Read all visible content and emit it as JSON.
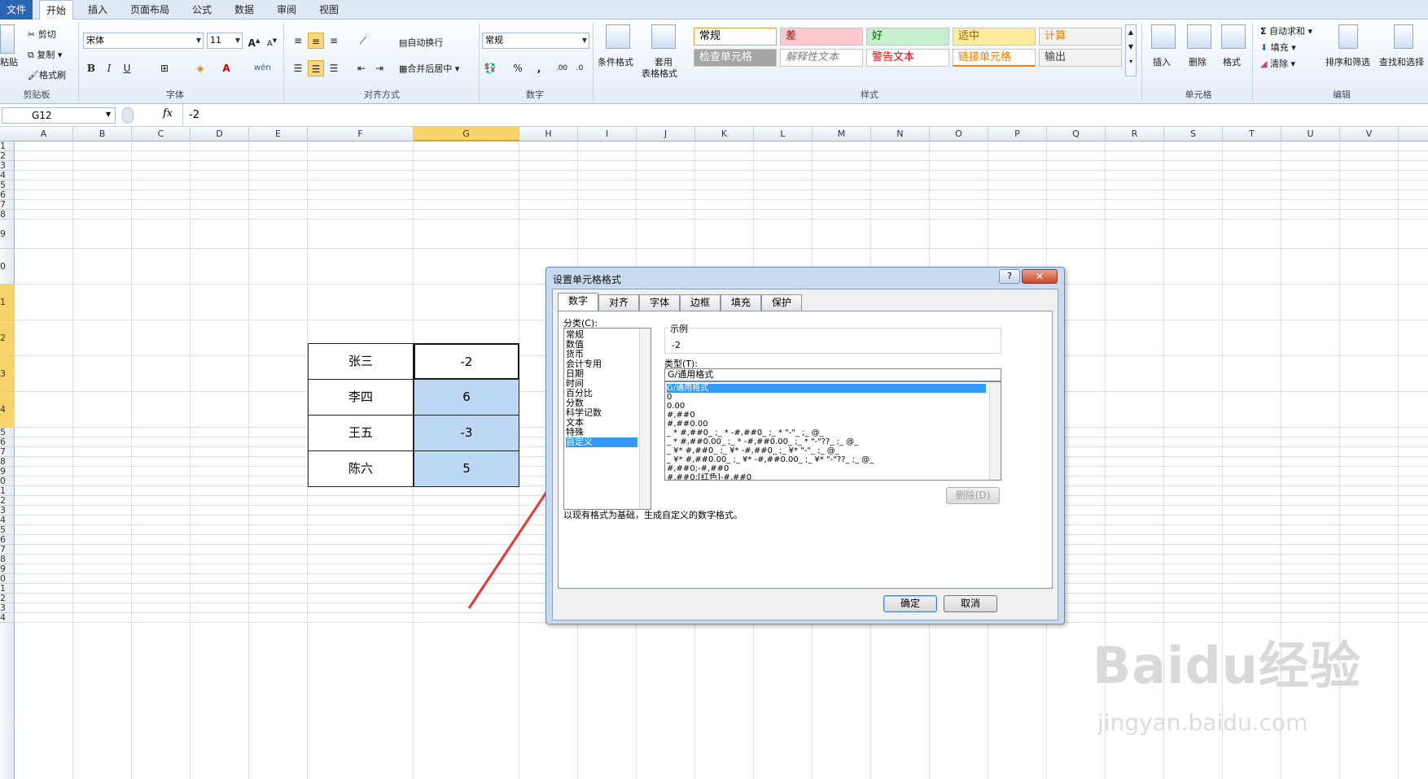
{
  "tabs": [
    "文件",
    "开始",
    "插入",
    "页面布局",
    "公式",
    "数据",
    "审阅",
    "视图"
  ],
  "clipboard": {
    "paste": "粘贴",
    "cut": "剪切",
    "copy": "复制",
    "painter": "格式刷",
    "label": "剪贴板"
  },
  "font": {
    "name": "宋体",
    "size": "11",
    "label": "字体",
    "bold": "B",
    "italic": "I",
    "underline": "U"
  },
  "align": {
    "wrap": "自动换行",
    "merge": "合并后居中",
    "label": "对齐方式"
  },
  "number": {
    "format": "常规",
    "percent": "%",
    "comma": ",",
    "label": "数字"
  },
  "styles": {
    "cond": "条件格式",
    "table": "套用",
    "table2": "表格格式",
    "label": "样式",
    "boxes": [
      {
        "text": "常规",
        "bg": "#ffffff",
        "color": "#000000"
      },
      {
        "text": "差",
        "bg": "#ffc7ce",
        "color": "#9c0006"
      },
      {
        "text": "好",
        "bg": "#c6efce",
        "color": "#006100"
      },
      {
        "text": "适中",
        "bg": "#ffeb9c",
        "color": "#9c6500"
      },
      {
        "text": "计算",
        "bg": "#f2f2f2",
        "color": "#fa7d00"
      },
      {
        "text": "检查单元格",
        "bg": "#a5a5a5",
        "color": "#ffffff"
      },
      {
        "text": "解释性文本",
        "bg": "#ffffff",
        "color": "#7f7f7f"
      },
      {
        "text": "警告文本",
        "bg": "#ffffff",
        "color": "#ff0000"
      },
      {
        "text": "链接单元格",
        "bg": "#ffffff",
        "color": "#fa7d00"
      },
      {
        "text": "输出",
        "bg": "#f2f2f2",
        "color": "#3f3f3f"
      }
    ]
  },
  "cellsgrp": {
    "insert": "插入",
    "delete": "删除",
    "format": "格式",
    "label": "单元格"
  },
  "editing": {
    "autosum": "自动求和",
    "fill": "填充",
    "clear": "清除",
    "sort": "排序和筛选",
    "find": "查找和选择",
    "label": "编辑"
  },
  "formula": {
    "namebox": "G12",
    "fx": "fx",
    "value": "-2"
  },
  "columns": [
    "A",
    "B",
    "C",
    "D",
    "E",
    "F",
    "G",
    "H",
    "I",
    "J",
    "K",
    "L",
    "M",
    "N",
    "O",
    "P",
    "Q",
    "R",
    "S",
    "T",
    "U",
    "V"
  ],
  "rows": [
    "1",
    "2",
    "3",
    "4",
    "5",
    "6",
    "7",
    "8",
    "9",
    "0",
    "1",
    "2",
    "3",
    "4",
    "5",
    "6",
    "7",
    "8",
    "9",
    "0",
    "1",
    "2",
    "3",
    "4",
    "5",
    "6",
    "7",
    "8",
    "9",
    "0",
    "1",
    "2",
    "3",
    "4"
  ],
  "table": [
    {
      "name": "张三",
      "value": "-2"
    },
    {
      "name": "李四",
      "value": "6"
    },
    {
      "name": "王五",
      "value": "-3"
    },
    {
      "name": "陈六",
      "value": "5"
    }
  ],
  "dialog": {
    "title": "设置单元格格式",
    "help": "?",
    "close": "✕",
    "tabs": [
      "数字",
      "对齐",
      "字体",
      "边框",
      "填充",
      "保护"
    ],
    "category_label": "分类(C):",
    "categories": [
      "常规",
      "数值",
      "货币",
      "会计专用",
      "日期",
      "时间",
      "百分比",
      "分数",
      "科学记数",
      "文本",
      "特殊",
      "自定义"
    ],
    "sample_label": "示例",
    "sample_value": "-2",
    "type_label": "类型(T):",
    "type_value": "G/通用格式",
    "types": [
      "G/通用格式",
      "0",
      "0.00",
      "#,##0",
      "#,##0.00",
      "_ * #,##0_ ;_ * -#,##0_ ;_ * \"-\"_ ;_ @_",
      "_ * #,##0.00_ ;_ * -#,##0.00_ ;_ * \"-\"??_ ;_ @_",
      "_ ¥* #,##0_ ;_ ¥* -#,##0_ ;_ ¥* \"-\"_ ;_ @_",
      "_ ¥* #,##0.00_ ;_ ¥* -#,##0.00_ ;_ ¥* \"-\"??_ ;_ @_",
      "#,##0;-#,##0",
      "#,##0;[红色]-#,##0"
    ],
    "delete_btn": "删除(D)",
    "description": "以现有格式为基础，生成自定义的数字格式。",
    "ok": "确定",
    "cancel": "取消"
  },
  "watermark": {
    "main": "Baidu经验",
    "sub": "jingyan.baidu.com"
  },
  "colors": {
    "selection": "#bcd8f4",
    "accent": "#2a66b8",
    "arrow": "#e8372f"
  }
}
